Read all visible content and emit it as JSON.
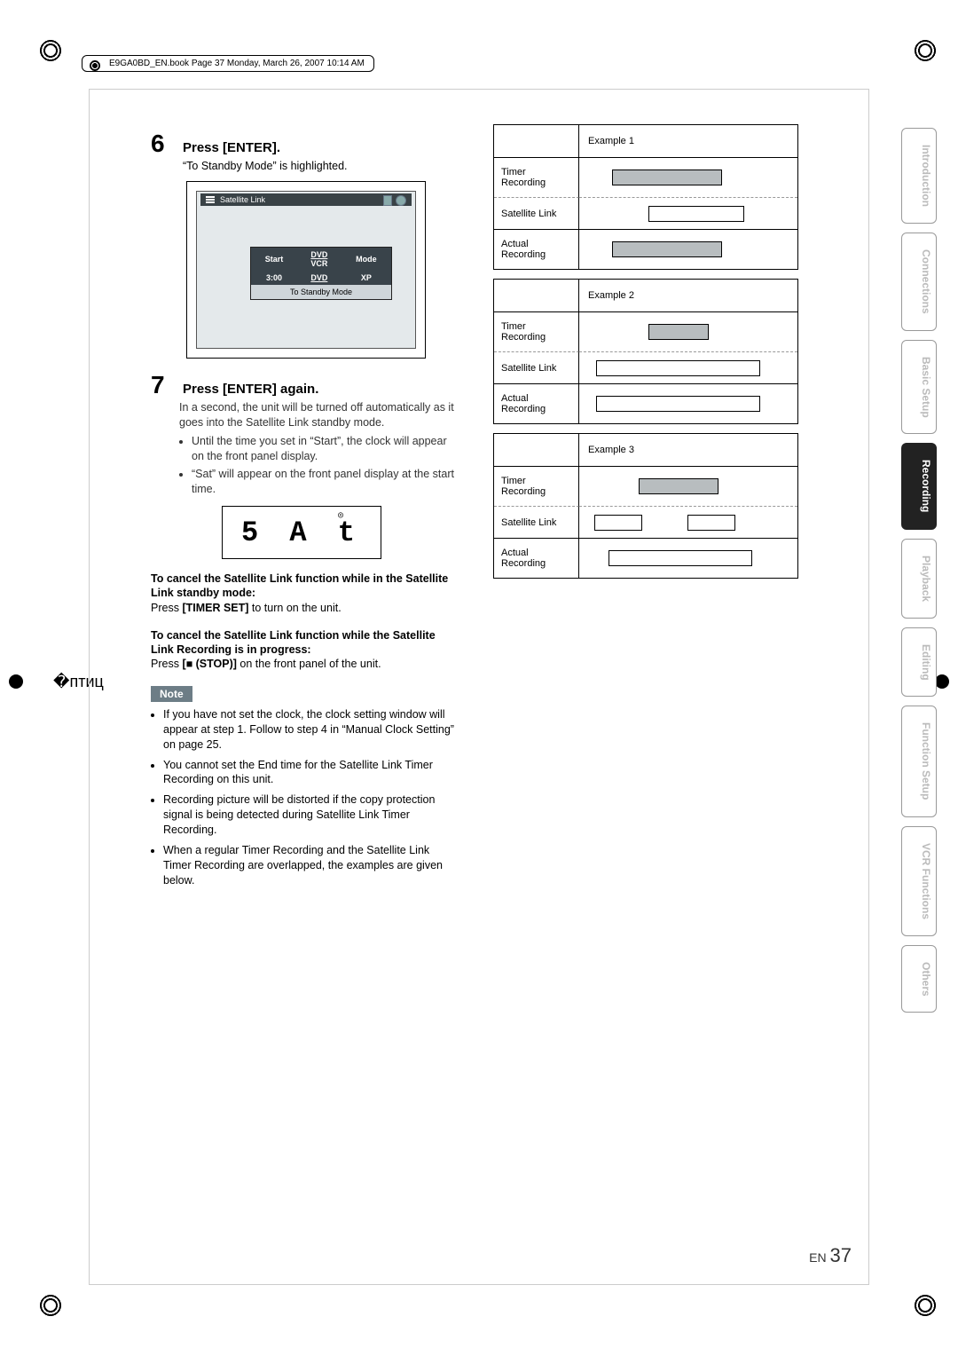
{
  "header": {
    "file_info": "E9GA0BD_EN.book  Page 37  Monday, March 26, 2007  10:14 AM"
  },
  "tabs": [
    {
      "label": "Introduction",
      "active": false
    },
    {
      "label": "Connections",
      "active": false
    },
    {
      "label": "Basic Setup",
      "active": false
    },
    {
      "label": "Recording",
      "active": true
    },
    {
      "label": "Playback",
      "active": false
    },
    {
      "label": "Editing",
      "active": false
    },
    {
      "label": "Function Setup",
      "active": false
    },
    {
      "label": "VCR Functions",
      "active": false
    },
    {
      "label": "Others",
      "active": false
    }
  ],
  "steps": {
    "step6": {
      "num": "6",
      "title": "Press [ENTER].",
      "sub": "“To Standby Mode” is highlighted."
    },
    "screen": {
      "title": "Satellite Link",
      "col_start": "Start",
      "col_dvdvcr_1": "DVD",
      "col_dvdvcr_2": "VCR",
      "col_mode": "Mode",
      "val_time": "3:00",
      "val_dvd": "DVD",
      "val_xp": "XP",
      "standby": "To Standby Mode"
    },
    "step7": {
      "num": "7",
      "title": "Press [ENTER] again.",
      "body": "In a second, the unit will be turned off automatically as it goes into the Satellite Link standby mode.",
      "bullet1": "Until the time you set in “Start”, the clock will appear on the front panel display.",
      "bullet2": "“Sat” will appear on the front panel display at the start time."
    },
    "seg": {
      "text": "5 A t",
      "icon": "⦿"
    },
    "cancel1_head": "To cancel the Satellite Link function while in the Satellite Link standby mode:",
    "cancel1_body_a": "Press ",
    "cancel1_body_b": "[TIMER SET]",
    "cancel1_body_c": " to turn on the unit.",
    "cancel2_head": "To cancel the Satellite Link function while the Satellite Link Recording is in progress:",
    "cancel2_body_a": "Press ",
    "cancel2_body_b": "[■ (STOP)]",
    "cancel2_body_c": " on the front panel of the unit.",
    "note_label": "Note",
    "notes": [
      "If you have not set the clock, the clock setting window will appear at step 1. Follow to step 4 in “Manual Clock Setting” on page 25.",
      "You cannot set the End time for the Satellite Link Timer Recording on this unit.",
      "Recording picture will be distorted if the copy protection signal is being detected during Satellite Link Timer Recording.",
      "When a regular Timer Recording and the Satellite Link Timer Recording are overlapped, the examples are given below."
    ]
  },
  "examples": {
    "labels": {
      "timer": "Timer Recording",
      "sat": "Satellite Link",
      "actual": "Actual Recording"
    },
    "ex1": "Example 1",
    "ex2": "Example 2",
    "ex3": "Example 3"
  },
  "footer": {
    "lang": "EN",
    "page": "37"
  }
}
